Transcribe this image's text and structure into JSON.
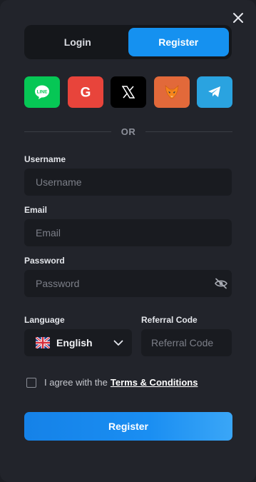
{
  "tabs": {
    "login": "Login",
    "register": "Register",
    "active": "register"
  },
  "socials": [
    {
      "name": "line-icon",
      "glyph": "LINE",
      "color": "#06c755"
    },
    {
      "name": "google-icon",
      "glyph": "G",
      "color": "#e8443b"
    },
    {
      "name": "x-icon",
      "glyph": "X",
      "color": "#000000"
    },
    {
      "name": "metamask-icon",
      "glyph": "",
      "color": "#e2693a"
    },
    {
      "name": "telegram-icon",
      "glyph": "",
      "color": "#2aa3e0"
    }
  ],
  "divider": "OR",
  "form": {
    "username_label": "Username",
    "username_placeholder": "Username",
    "email_label": "Email",
    "email_placeholder": "Email",
    "password_label": "Password",
    "password_placeholder": "Password",
    "language_label": "Language",
    "language_value": "English",
    "referral_label": "Referral Code",
    "referral_placeholder": "Referral Code",
    "agree_text": "I agree with the",
    "terms_link": "Terms & Conditions",
    "submit_label": "Register"
  },
  "colors": {
    "accent": "#1591f0",
    "background": "#22242b",
    "field": "#191b20"
  }
}
